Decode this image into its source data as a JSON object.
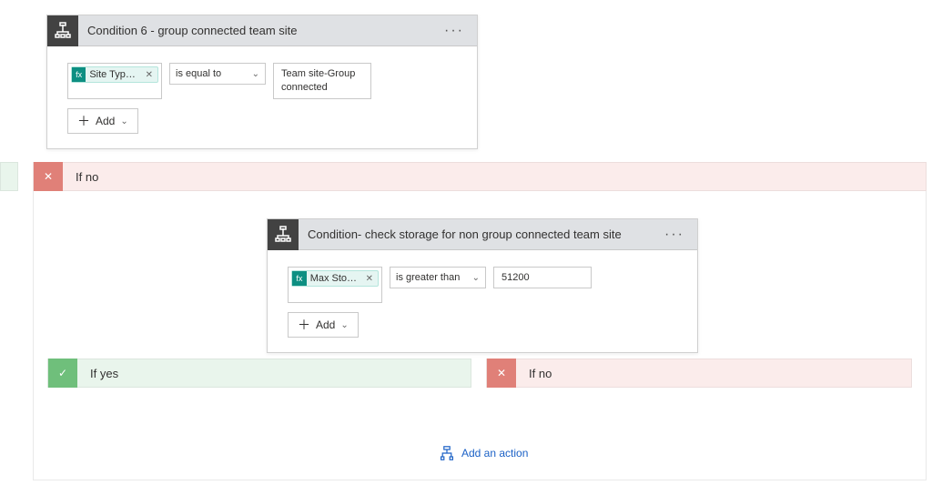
{
  "condition1": {
    "title": "Condition 6 - group connected team site",
    "pill_label": "Site Type…",
    "pill_icon": "fx",
    "operator": "is equal to",
    "value": "Team site-Group connected",
    "add_label": "Add"
  },
  "branch_if_no": "If no",
  "condition2": {
    "title": "Condition- check storage for non group connected team site",
    "pill_label": "Max Stor…",
    "pill_icon": "fx",
    "operator": "is greater than",
    "value": "51200",
    "add_label": "Add"
  },
  "branch_yes": "If yes",
  "branch_no2": "If no",
  "add_action": "Add an action",
  "glyphs": {
    "x": "✕",
    "check": "✓",
    "plus": "＋",
    "chev_down": "⌄",
    "dots": "···"
  }
}
